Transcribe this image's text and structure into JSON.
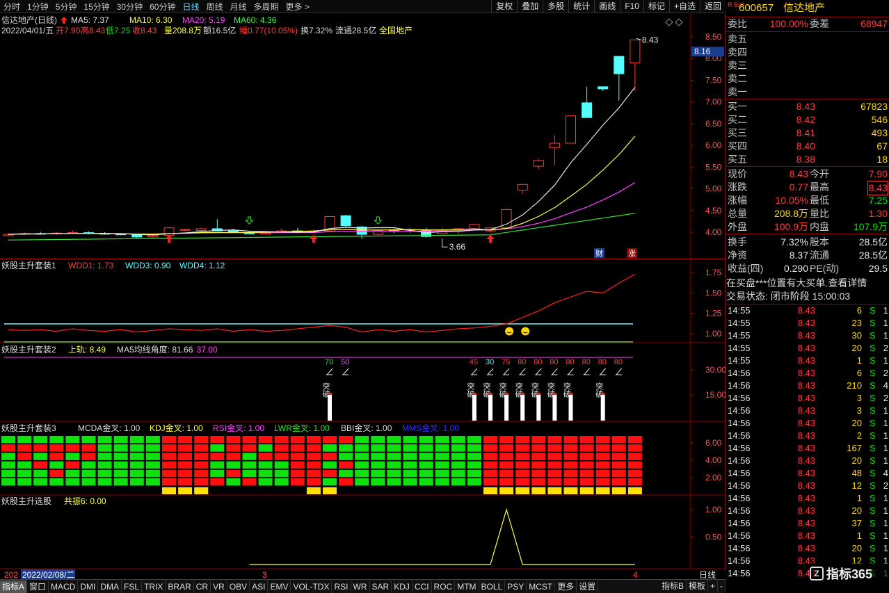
{
  "topbar": {
    "tabs": [
      "分时",
      "1分钟",
      "5分钟",
      "15分钟",
      "30分钟",
      "60分钟",
      "日线",
      "周线",
      "月线",
      "多周期",
      "更多 >"
    ],
    "active": "日线",
    "right_buttons": [
      "复权",
      "叠加",
      "多股",
      "统计",
      "画线",
      "F10",
      "标记",
      "+自选",
      "返回"
    ]
  },
  "main": {
    "name": "信达地产(日线)",
    "ma5": "MA5: 7.37",
    "ma10": "MA10: 6.30",
    "ma20": "MA20: 5.19",
    "ma60": "MA60: 4.36",
    "info_date": "2022/04/01/五",
    "info_open": "开7.90",
    "info_high": "高8.43",
    "info_low": "低7.25",
    "info_close": "收8.43",
    "info_vol": "量208.8万",
    "info_amt": "额16.5亿",
    "info_range": "幅0.77(10.05%)",
    "info_turn": "换7.32%",
    "info_float": "流通28.5亿",
    "info_market": "全国地产",
    "high_label": "8.43",
    "low_label": "3.66",
    "price_tag": "8.16",
    "yticks": [
      "8.50",
      "8.00",
      "7.50",
      "7.00",
      "6.50",
      "6.00",
      "5.50",
      "5.00",
      "4.50",
      "4.00"
    ],
    "badges": [
      "财",
      "涨"
    ]
  },
  "panel1": {
    "title": "妖股主升套装1",
    "wdd1": "WDD1: 1.73",
    "wdd3": "WDD3: 0.90",
    "wdd4": "WDD4: 1.12",
    "yticks": [
      "1.75",
      "1.50",
      "1.25",
      "1.00"
    ]
  },
  "panel2": {
    "title": "妖股主升套装2",
    "up": "上轨: 8.49",
    "angle": "MA5均线角度: 81.66",
    "extra": ": 37.00",
    "yticks": [
      "30.00",
      "15.00"
    ],
    "labels": [
      "70",
      "50",
      "45",
      "30",
      "75",
      "80",
      "80",
      "80",
      "80",
      "80",
      "80"
    ],
    "tupo": "突破"
  },
  "panel3": {
    "title": "妖股主升套装3",
    "macd": "MCDA金叉: 1.00",
    "kdj": "KDJ金叉: 1.00",
    "rsi": "RSI金叉: 1.00",
    "lwr": "LWR金叉: 1.00",
    "bbi": "BBI金叉: 1.00",
    "mms": "MMS金叉: 1.00",
    "yticks": [
      "6.00",
      "4.00",
      "2.00"
    ]
  },
  "panel4": {
    "title": "妖股主升选股",
    "gz": "共振6: 0.00",
    "yticks": [
      "1.00",
      "0.50"
    ]
  },
  "axis": {
    "start": "202",
    "date": "2022/02/08/二",
    "m3": "3",
    "m4": "4",
    "period": "日线"
  },
  "bottom": [
    "指标A",
    "窗口",
    "MACD",
    "DMI",
    "DMA",
    "FSL",
    "TRIX",
    "BRAR",
    "CR",
    "VR",
    "OBV",
    "ASI",
    "EMV",
    "VOL-TDX",
    "RSI",
    "WR",
    "SAR",
    "KDJ",
    "CCI",
    "ROC",
    "MTM",
    "BOLL",
    "PSY",
    "MCST",
    "更多",
    "设置"
  ],
  "bottom_right": [
    "指标B",
    "模板",
    "+",
    "-"
  ],
  "stock": {
    "code": "600657",
    "name": "信达地产",
    "tag": "R 500"
  },
  "book": {
    "weibi_l": "委比",
    "weibi_v": "100.00%",
    "weicha_l": "委差",
    "weicha_v": "68947",
    "sell": [
      "卖五",
      "卖四",
      "卖三",
      "卖二",
      "卖一"
    ],
    "buy": [
      {
        "l": "买一",
        "p": "8.43",
        "v": "67823"
      },
      {
        "l": "买二",
        "p": "8.42",
        "v": "546"
      },
      {
        "l": "买三",
        "p": "8.41",
        "v": "493"
      },
      {
        "l": "买四",
        "p": "8.40",
        "v": "67"
      },
      {
        "l": "买五",
        "p": "8.38",
        "v": "18"
      }
    ]
  },
  "quote": [
    {
      "l1": "现价",
      "v1": "8.43",
      "l2": "今开",
      "v2": "7.90"
    },
    {
      "l1": "涨跌",
      "v1": "0.77",
      "l2": "最高",
      "v2": "8.43"
    },
    {
      "l1": "涨幅",
      "v1": "10.05%",
      "l2": "最低",
      "v2": "7.25"
    },
    {
      "l1": "总量",
      "v1": "208.8万",
      "l2": "量比",
      "v2": "1.30"
    },
    {
      "l1": "外盘",
      "v1": "100.9万",
      "l2": "内盘",
      "v2": "107.9万"
    },
    {
      "l1": "换手",
      "v1": "7.32%",
      "l2": "股本",
      "v2": "28.5亿"
    },
    {
      "l1": "净资",
      "v1": "8.37",
      "l2": "流通",
      "v2": "28.5亿"
    },
    {
      "l1": "收益(四)",
      "v1": "0.290",
      "l2": "PE(动)",
      "v2": "29.5"
    }
  ],
  "notice": "在买盘***位置有大买单.查看详情",
  "status": "交易状态: 闭市阶段 15:00:03",
  "ticks": [
    [
      "14:55",
      "8.43",
      "6",
      "S",
      "1"
    ],
    [
      "14:55",
      "8.43",
      "23",
      "S",
      "1"
    ],
    [
      "14:55",
      "8.43",
      "30",
      "S",
      "1"
    ],
    [
      "14:55",
      "8.43",
      "20",
      "S",
      "2"
    ],
    [
      "14:55",
      "8.43",
      "1",
      "S",
      "1"
    ],
    [
      "14:56",
      "8.43",
      "6",
      "S",
      "2"
    ],
    [
      "14:56",
      "8.43",
      "210",
      "S",
      "4"
    ],
    [
      "14:56",
      "8.43",
      "3",
      "S",
      "2"
    ],
    [
      "14:56",
      "8.43",
      "3",
      "S",
      "1"
    ],
    [
      "14:56",
      "8.43",
      "20",
      "S",
      "1"
    ],
    [
      "14:56",
      "8.43",
      "2",
      "S",
      "1"
    ],
    [
      "14:56",
      "8.43",
      "167",
      "S",
      "1"
    ],
    [
      "14:56",
      "8.43",
      "20",
      "S",
      "1"
    ],
    [
      "14:56",
      "8.43",
      "48",
      "S",
      "4"
    ],
    [
      "14:56",
      "8.43",
      "12",
      "S",
      "2"
    ],
    [
      "14:56",
      "8.43",
      "1",
      "S",
      "1"
    ],
    [
      "14:56",
      "8.43",
      "20",
      "S",
      "1"
    ],
    [
      "14:56",
      "8.43",
      "37",
      "S",
      "1"
    ],
    [
      "14:56",
      "8.43",
      "1",
      "S",
      "1"
    ],
    [
      "14:56",
      "8.43",
      "20",
      "S",
      "1"
    ],
    [
      "14:56",
      "8.43",
      "12",
      "S",
      "1"
    ],
    [
      "14:56",
      "8.43",
      "1",
      "S",
      "1"
    ]
  ],
  "logo": "指标365"
}
